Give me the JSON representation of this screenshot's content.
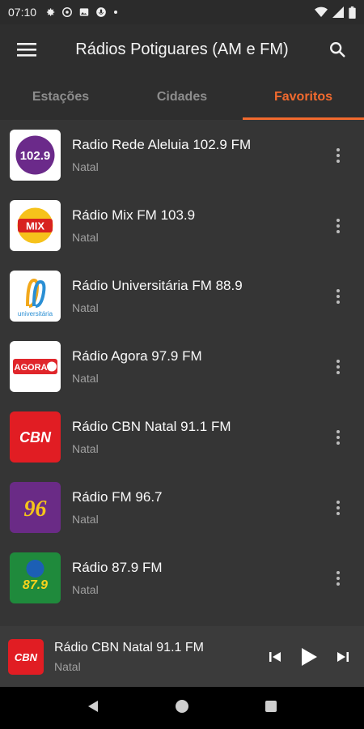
{
  "status": {
    "time": "07:10"
  },
  "appbar": {
    "title": "Rádios Potiguares (AM e FM)"
  },
  "tabs": [
    {
      "label": "Estações"
    },
    {
      "label": "Cidades"
    },
    {
      "label": "Favoritos"
    }
  ],
  "stations": [
    {
      "name": "Radio Rede Aleluia 102.9 FM",
      "city": "Natal",
      "logo_text": "102.9"
    },
    {
      "name": "Rádio Mix FM 103.9",
      "city": "Natal",
      "logo_text": "MIX"
    },
    {
      "name": "Rádio Universitária FM 88.9",
      "city": "Natal",
      "logo_text": "universitária"
    },
    {
      "name": "Rádio Agora 97.9 FM",
      "city": "Natal",
      "logo_text": "AGORA"
    },
    {
      "name": "Rádio CBN Natal 91.1 FM",
      "city": "Natal",
      "logo_text": "CBN"
    },
    {
      "name": "Rádio FM 96.7",
      "city": "Natal",
      "logo_text": "96"
    },
    {
      "name": "Rádio 87.9 FM",
      "city": "Natal",
      "logo_text": "87.9"
    }
  ],
  "player": {
    "name": "Rádio CBN Natal 91.1 FM",
    "city": "Natal",
    "logo_text": "CBN"
  },
  "colors": {
    "accent": "#f26a2e",
    "background": "#353535",
    "appbar": "#2e2e2e"
  },
  "icons": [
    "menu-icon",
    "search-icon",
    "more-vert-icon",
    "skip-previous-icon",
    "play-icon",
    "skip-next-icon",
    "nav-back-icon",
    "nav-home-icon",
    "nav-recents-icon"
  ]
}
